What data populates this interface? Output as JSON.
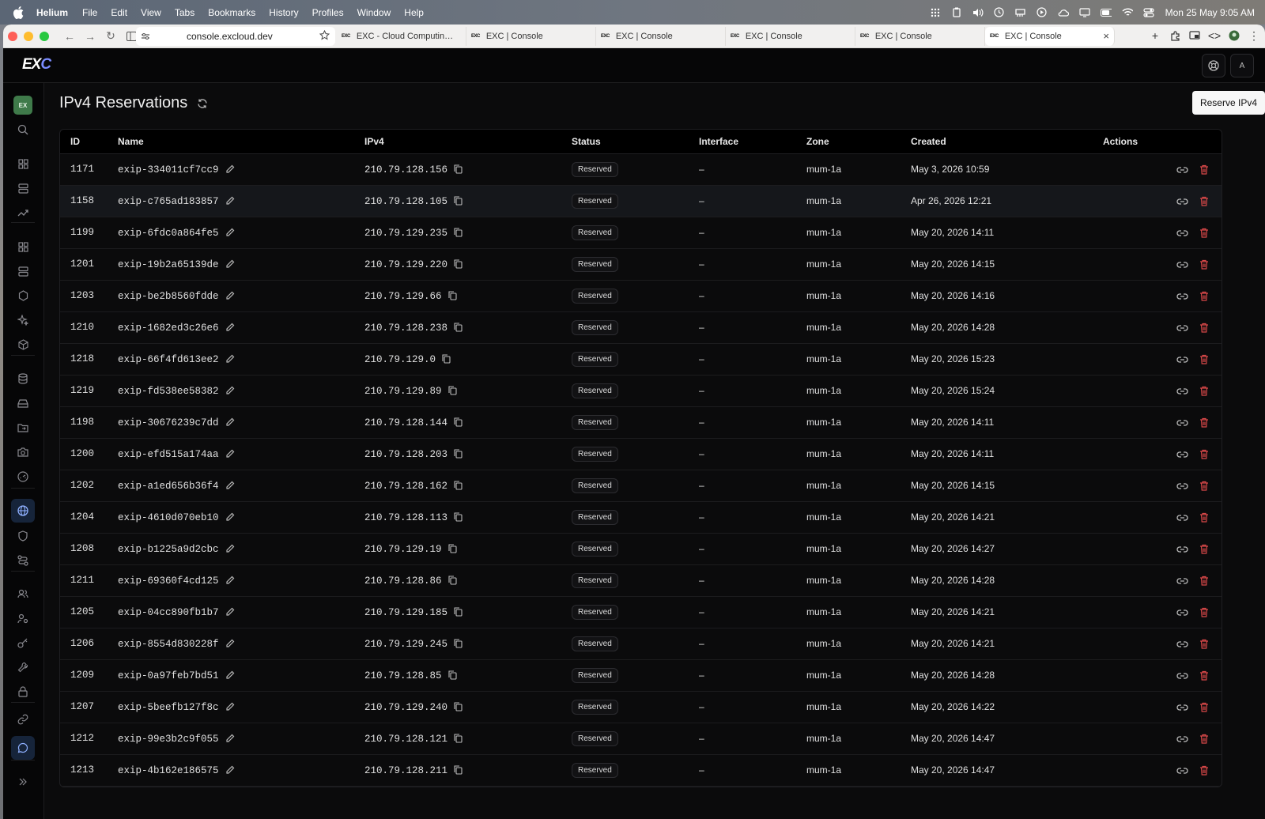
{
  "menubar": {
    "app_name": "Helium",
    "items": [
      "File",
      "Edit",
      "View",
      "Tabs",
      "Bookmarks",
      "History",
      "Profiles",
      "Window",
      "Help"
    ],
    "clock": "Mon 25 May  9:05 AM"
  },
  "browser": {
    "url": "console.excloud.dev",
    "tabs": [
      {
        "favicon": "EXC",
        "label": "EXC - Cloud Computing Serv"
      },
      {
        "favicon": "EXC",
        "label": "EXC | Console"
      },
      {
        "favicon": "EXC",
        "label": "EXC | Console"
      },
      {
        "favicon": "EXC",
        "label": "EXC | Console"
      },
      {
        "favicon": "EXC",
        "label": "EXC | Console"
      },
      {
        "favicon": "EXC",
        "label": "EXC | Console",
        "active": true
      }
    ]
  },
  "app": {
    "logo_main": "EX",
    "logo_accent": "C",
    "user_initial": "A",
    "org_badge": "EX"
  },
  "page": {
    "title": "IPv4 Reservations",
    "primary_button": "Reserve IPv4"
  },
  "table": {
    "columns": [
      "ID",
      "Name",
      "IPv4",
      "Status",
      "Interface",
      "Zone",
      "Created",
      "Actions"
    ],
    "rows": [
      {
        "id": "1171",
        "name": "exip-334011cf7cc9",
        "ipv4": "210.79.128.156",
        "status": "Reserved",
        "interface": "–",
        "zone": "mum-1a",
        "created": "May 3, 2026 10:59"
      },
      {
        "id": "1158",
        "name": "exip-c765ad183857",
        "ipv4": "210.79.128.105",
        "status": "Reserved",
        "interface": "–",
        "zone": "mum-1a",
        "created": "Apr 26, 2026 12:21"
      },
      {
        "id": "1199",
        "name": "exip-6fdc0a864fe5",
        "ipv4": "210.79.129.235",
        "status": "Reserved",
        "interface": "–",
        "zone": "mum-1a",
        "created": "May 20, 2026 14:11"
      },
      {
        "id": "1201",
        "name": "exip-19b2a65139de",
        "ipv4": "210.79.129.220",
        "status": "Reserved",
        "interface": "–",
        "zone": "mum-1a",
        "created": "May 20, 2026 14:15"
      },
      {
        "id": "1203",
        "name": "exip-be2b8560fdde",
        "ipv4": "210.79.129.66",
        "status": "Reserved",
        "interface": "–",
        "zone": "mum-1a",
        "created": "May 20, 2026 14:16"
      },
      {
        "id": "1210",
        "name": "exip-1682ed3c26e6",
        "ipv4": "210.79.128.238",
        "status": "Reserved",
        "interface": "–",
        "zone": "mum-1a",
        "created": "May 20, 2026 14:28"
      },
      {
        "id": "1218",
        "name": "exip-66f4fd613ee2",
        "ipv4": "210.79.129.0",
        "status": "Reserved",
        "interface": "–",
        "zone": "mum-1a",
        "created": "May 20, 2026 15:23"
      },
      {
        "id": "1219",
        "name": "exip-fd538ee58382",
        "ipv4": "210.79.129.89",
        "status": "Reserved",
        "interface": "–",
        "zone": "mum-1a",
        "created": "May 20, 2026 15:24"
      },
      {
        "id": "1198",
        "name": "exip-30676239c7dd",
        "ipv4": "210.79.128.144",
        "status": "Reserved",
        "interface": "–",
        "zone": "mum-1a",
        "created": "May 20, 2026 14:11"
      },
      {
        "id": "1200",
        "name": "exip-efd515a174aa",
        "ipv4": "210.79.128.203",
        "status": "Reserved",
        "interface": "–",
        "zone": "mum-1a",
        "created": "May 20, 2026 14:11"
      },
      {
        "id": "1202",
        "name": "exip-a1ed656b36f4",
        "ipv4": "210.79.128.162",
        "status": "Reserved",
        "interface": "–",
        "zone": "mum-1a",
        "created": "May 20, 2026 14:15"
      },
      {
        "id": "1204",
        "name": "exip-4610d070eb10",
        "ipv4": "210.79.128.113",
        "status": "Reserved",
        "interface": "–",
        "zone": "mum-1a",
        "created": "May 20, 2026 14:21"
      },
      {
        "id": "1208",
        "name": "exip-b1225a9d2cbc",
        "ipv4": "210.79.129.19",
        "status": "Reserved",
        "interface": "–",
        "zone": "mum-1a",
        "created": "May 20, 2026 14:27"
      },
      {
        "id": "1211",
        "name": "exip-69360f4cd125",
        "ipv4": "210.79.128.86",
        "status": "Reserved",
        "interface": "–",
        "zone": "mum-1a",
        "created": "May 20, 2026 14:28"
      },
      {
        "id": "1205",
        "name": "exip-04cc890fb1b7",
        "ipv4": "210.79.129.185",
        "status": "Reserved",
        "interface": "–",
        "zone": "mum-1a",
        "created": "May 20, 2026 14:21"
      },
      {
        "id": "1206",
        "name": "exip-8554d830228f",
        "ipv4": "210.79.129.245",
        "status": "Reserved",
        "interface": "–",
        "zone": "mum-1a",
        "created": "May 20, 2026 14:21"
      },
      {
        "id": "1209",
        "name": "exip-0a97feb7bd51",
        "ipv4": "210.79.128.85",
        "status": "Reserved",
        "interface": "–",
        "zone": "mum-1a",
        "created": "May 20, 2026 14:28"
      },
      {
        "id": "1207",
        "name": "exip-5beefb127f8c",
        "ipv4": "210.79.129.240",
        "status": "Reserved",
        "interface": "–",
        "zone": "mum-1a",
        "created": "May 20, 2026 14:22"
      },
      {
        "id": "1212",
        "name": "exip-99e3b2c9f055",
        "ipv4": "210.79.128.121",
        "status": "Reserved",
        "interface": "–",
        "zone": "mum-1a",
        "created": "May 20, 2026 14:47"
      },
      {
        "id": "1213",
        "name": "exip-4b162e186575",
        "ipv4": "210.79.128.211",
        "status": "Reserved",
        "interface": "–",
        "zone": "mum-1a",
        "created": "May 20, 2026 14:47"
      }
    ]
  },
  "sidebar": {
    "icons": [
      "search-icon",
      "dashboard-icon",
      "servers-icon",
      "metrics-icon",
      "apps-icon",
      "storage-icon",
      "hexagon-icon",
      "sparkle-icon",
      "box-icon",
      "database-icon",
      "drive-icon",
      "folder-sync-icon",
      "camera-icon",
      "gauge-icon",
      "globe-icon",
      "shield-icon",
      "route-icon",
      "users-icon",
      "user-cog-icon",
      "key-icon",
      "wrench-icon",
      "lock-icon",
      "link-icon",
      "chat-icon",
      "expand-icon"
    ],
    "active": "globe-icon"
  },
  "colors": {
    "accent": "#7b8cff",
    "danger": "#d94848",
    "active_nav": "#16243a"
  }
}
